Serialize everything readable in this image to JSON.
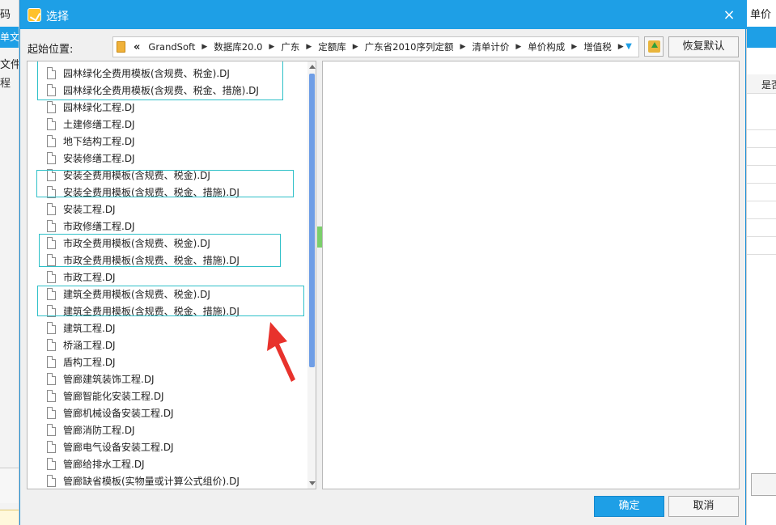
{
  "background": {
    "left_title_fragment": "码",
    "left_bar_fragment": "单文件",
    "left_tab_fragment": "文件",
    "left_item_fragment": "程",
    "right_header_fragment": "单价",
    "right_column_fragment": "是否"
  },
  "dialog": {
    "title": "选择",
    "close_symbol": "×",
    "start_label": "起始位置:",
    "breadcrumb_prefix": "«",
    "breadcrumbs": [
      "GrandSoft",
      "数据库20.0",
      "广东",
      "定额库",
      "广东省2010序列定额",
      "清单计价",
      "单价构成",
      "增值税"
    ],
    "restore_button": "恢复默认",
    "ok_button": "确定",
    "cancel_button": "取消"
  },
  "files": [
    "园林绿化全费用模板(含规费、税金).DJ",
    "园林绿化全费用模板(含规费、税金、措施).DJ",
    "园林绿化工程.DJ",
    "土建修缮工程.DJ",
    "地下结构工程.DJ",
    "安装修缮工程.DJ",
    "安装全费用模板(含规费、税金).DJ",
    "安装全费用模板(含规费、税金、措施).DJ",
    "安装工程.DJ",
    "市政修缮工程.DJ",
    "市政全费用模板(含规费、税金).DJ",
    "市政全费用模板(含规费、税金、措施).DJ",
    "市政工程.DJ",
    "建筑全费用模板(含规费、税金).DJ",
    "建筑全费用模板(含规费、税金、措施).DJ",
    "建筑工程.DJ",
    "桥涵工程.DJ",
    "盾构工程.DJ",
    "管廊建筑装饰工程.DJ",
    "管廊智能化安装工程.DJ",
    "管廊机械设备安装工程.DJ",
    "管廊消防工程.DJ",
    "管廊电气设备安装工程.DJ",
    "管廊给排水工程.DJ",
    "管廊缺省模板(实物量或计算公式组价).DJ"
  ],
  "colors": {
    "accent": "#1e9fe6",
    "highlight_box": "#2ec0c8",
    "annotation_arrow": "#e8322c",
    "scroll_thumb": "#6f9ee6"
  }
}
